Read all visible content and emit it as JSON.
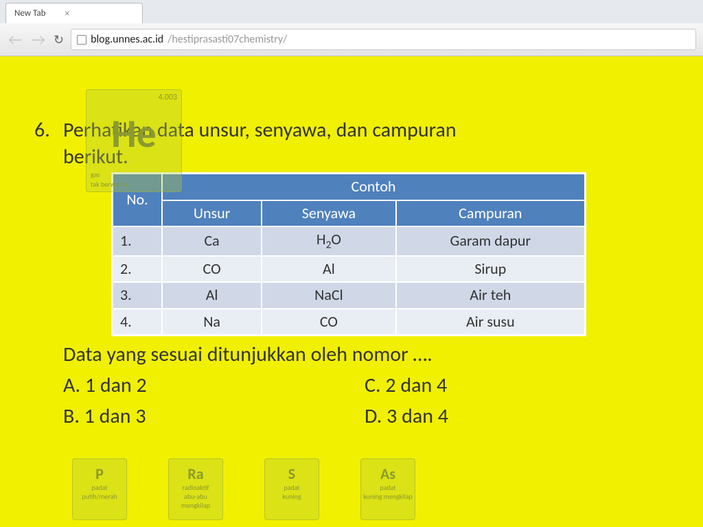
{
  "browser": {
    "tab_title": "New Tab",
    "url_host": "blog.unnes.ac.id",
    "url_path": "/hestiprasasti07chemistry/"
  },
  "question": {
    "number": "6.",
    "stem_line1": "Perhatikan data unsur, senyawa, dan campuran",
    "stem_line2": "berikut.",
    "prompt": "Data yang sesuai ditunjukkan oleh nomor ….",
    "options": {
      "a": "A. 1 dan 2",
      "b": "B. 1 dan 3",
      "c": "C. 2 dan 4",
      "d": "D. 3 dan 4"
    }
  },
  "table": {
    "headers": {
      "no": "No.",
      "contoh": "Contoh",
      "unsur": "Unsur",
      "senyawa": "Senyawa",
      "campuran": "Campuran"
    },
    "rows": [
      {
        "no": "1.",
        "unsur": "Ca",
        "senyawa": "H2O",
        "campuran": "Garam dapur"
      },
      {
        "no": "2.",
        "unsur": "CO",
        "senyawa": "Al",
        "campuran": "Sirup"
      },
      {
        "no": "3.",
        "unsur": "Al",
        "senyawa": "NaCl",
        "campuran": "Air teh"
      },
      {
        "no": "4.",
        "unsur": "Na",
        "senyawa": "CO",
        "campuran": "Air susu"
      }
    ]
  },
  "bg_tiles": {
    "he": {
      "sym": "He",
      "num": "4.003",
      "state": "gas",
      "note": "tak berwarna"
    },
    "p": {
      "sym": "P",
      "note1": "padat",
      "note2": "putih/merah"
    },
    "ra": {
      "sym": "Ra",
      "note1": "radioaktif",
      "note2": "abu-abu mengkilap"
    },
    "s": {
      "sym": "S",
      "note1": "padat",
      "note2": "kuning"
    },
    "as": {
      "sym": "As",
      "note1": "padat",
      "note2": "kuning mengkilap"
    }
  }
}
